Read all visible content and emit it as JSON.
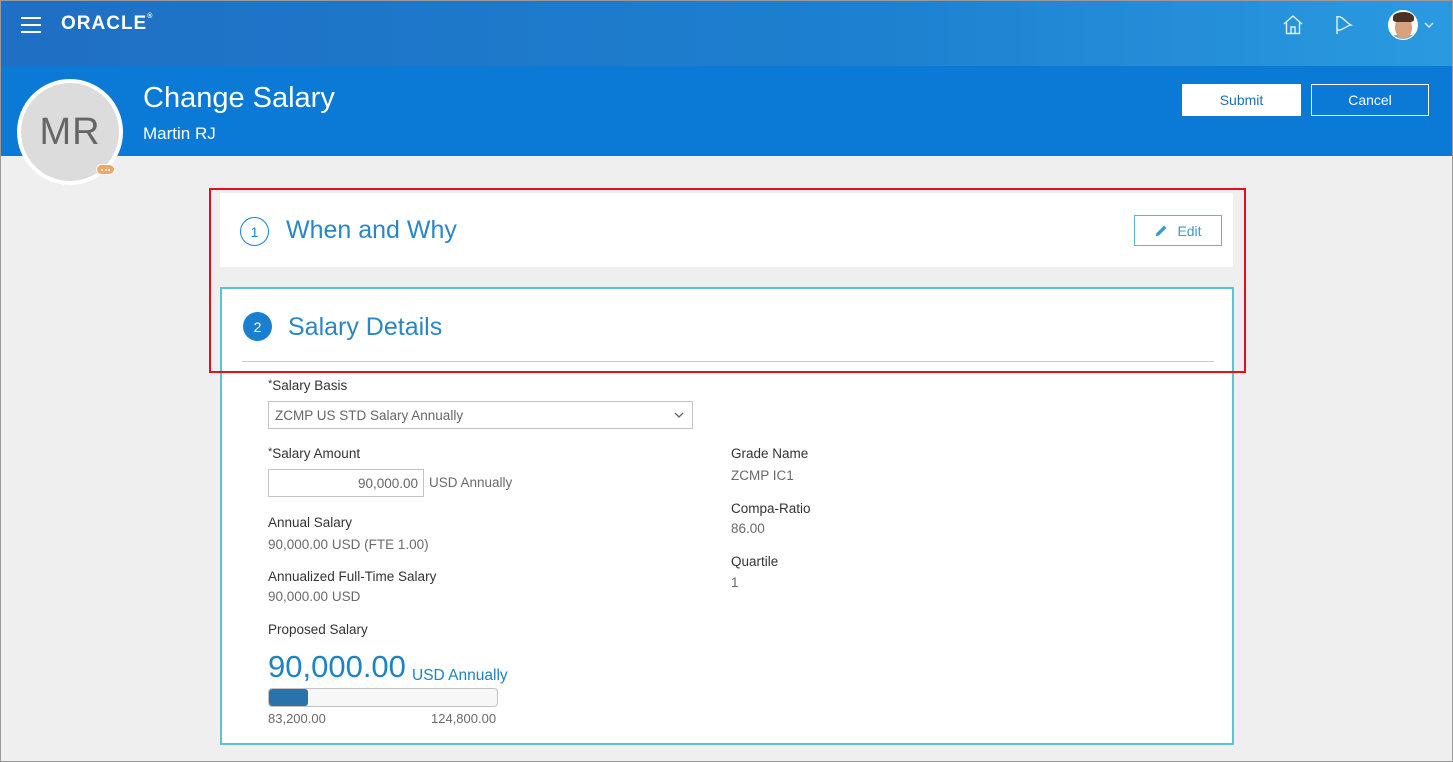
{
  "topbar": {
    "logo": "ORACLE",
    "logo_mark": "®",
    "icons": [
      "menu-icon",
      "home-icon",
      "notifications-flag-icon",
      "user-avatar",
      "chevron-down-icon"
    ]
  },
  "header": {
    "title": "Change Salary",
    "person_name": "Martin RJ",
    "initials": "MR",
    "submit_label": "Submit",
    "cancel_label": "Cancel"
  },
  "section1": {
    "number": "1",
    "title": "When and Why",
    "edit_label": "Edit"
  },
  "section2": {
    "number": "2",
    "title": "Salary Details",
    "salary_basis": {
      "required_mark": "*",
      "label": "Salary Basis",
      "value": "ZCMP US STD Salary Annually"
    },
    "salary_amount": {
      "required_mark": "*",
      "label": "Salary Amount",
      "value": "90,000.00",
      "unit": "USD Annually"
    },
    "annual_salary": {
      "label": "Annual Salary",
      "value": "90,000.00",
      "suffix": "USD (FTE 1.00)"
    },
    "annualized_fulltime": {
      "label": "Annualized Full-Time Salary",
      "value": "90,000.00",
      "suffix": "USD"
    },
    "proposed_salary": {
      "label": "Proposed Salary",
      "value": "90,000.00",
      "unit": "USD Annually",
      "range_min": "83,200.00",
      "range_max": "124,800.00",
      "range_fill_fraction": 0.17
    },
    "grade_name": {
      "label": "Grade Name",
      "value": "ZCMP IC1"
    },
    "compa_ratio": {
      "label": "Compa-Ratio",
      "value": "86.00"
    },
    "quartile": {
      "label": "Quartile",
      "value": "1"
    }
  },
  "colors": {
    "topbar": "#1f6fc4",
    "header": "#0a7ad6",
    "accent": "#2b86c5",
    "highlight": "#e3121a",
    "card_border": "#58c4d4"
  }
}
